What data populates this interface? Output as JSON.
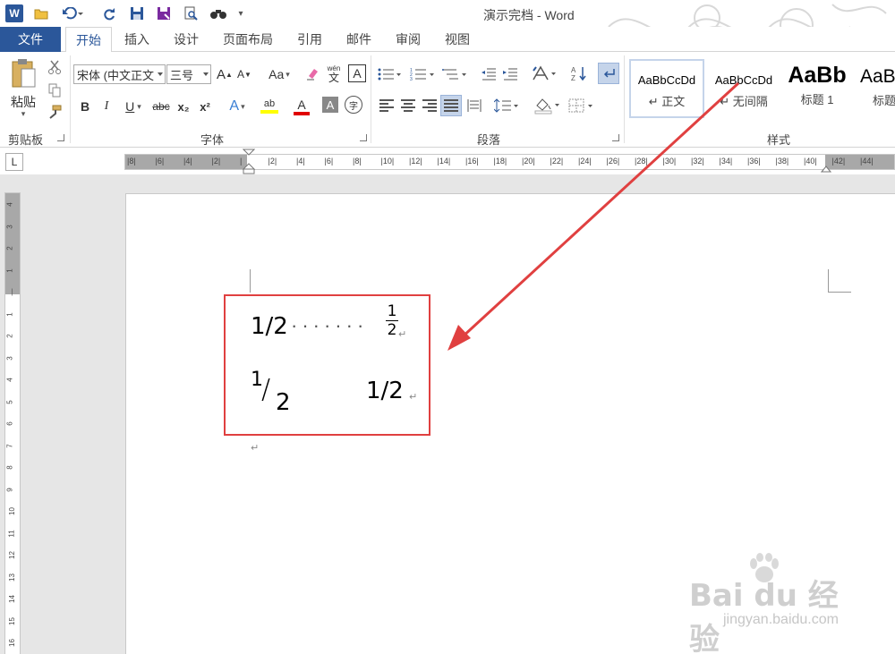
{
  "window": {
    "title": "演示完档 - Word"
  },
  "menu": {
    "file": "文件",
    "tabs": [
      "开始",
      "插入",
      "设计",
      "页面布局",
      "引用",
      "邮件",
      "审阅",
      "视图"
    ],
    "active": "开始"
  },
  "ribbon": {
    "clipboard": {
      "label": "剪贴板",
      "paste": "粘贴"
    },
    "font": {
      "label": "字体",
      "font_name": "宋体 (中文正文",
      "font_size": "三号",
      "bold": "B",
      "italic": "I",
      "underline": "U",
      "strike": "abc",
      "subscript": "x₂",
      "superscript": "x²",
      "grow": "A",
      "shrink": "A",
      "case": "Aa",
      "pinyin_top": "wén",
      "pinyin_bottom": "文",
      "char_border": "A",
      "font_color": "A",
      "shading": "A",
      "enclose": "字",
      "effects": "A",
      "highlight": "ab"
    },
    "paragraph": {
      "label": "段落"
    },
    "styles": {
      "label": "样式",
      "items": [
        {
          "sample": "AaBbCcDd",
          "name": "↵ 正文"
        },
        {
          "sample": "AaBbCcDd",
          "name": "↵ 无间隔"
        },
        {
          "sample": "AaBb",
          "name": "标题 1"
        },
        {
          "sample": "AaBb",
          "name": "标题"
        }
      ]
    }
  },
  "ruler": {
    "tab_selector": "L",
    "ticks": [
      "8",
      "6",
      "4",
      "2",
      "",
      "2",
      "4",
      "6",
      "8",
      "10",
      "12",
      "14",
      "16",
      "18",
      "20",
      "22",
      "24",
      "26",
      "28",
      "30",
      "32",
      "34",
      "36",
      "38",
      "40",
      "42",
      "44"
    ],
    "vticks": [
      "4",
      "3",
      "2",
      "1",
      "",
      "1",
      "2",
      "3",
      "4",
      "5",
      "6",
      "7",
      "8",
      "9",
      "10",
      "11",
      "12",
      "13",
      "14",
      "15",
      "16"
    ]
  },
  "document": {
    "line1_left": "1/2",
    "line1_right_num": "1",
    "line1_right_den": "2",
    "line2_left_num": "1",
    "line2_left_slash": "/",
    "line2_left_den": "2",
    "line2_right": "1/2",
    "para_mark": "↵",
    "leader_dots": "·······"
  },
  "watermark": {
    "logo": "Bai du 经验",
    "url": "jingyan.baidu.com"
  },
  "colors": {
    "accent": "#2b579a",
    "highlight_box": "#e04040",
    "arrow": "#e04040"
  }
}
